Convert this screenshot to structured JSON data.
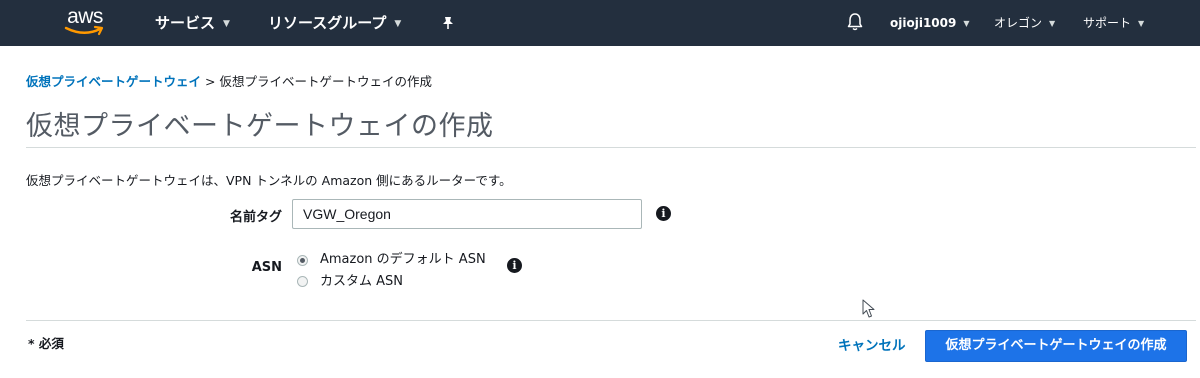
{
  "header": {
    "logo_text": "aws",
    "services_label": "サービス",
    "resource_groups_label": "リソースグループ",
    "pin_icon": "pin-icon",
    "bell_icon": "bell-icon",
    "account_label": "ojioji1009",
    "region_label": "オレゴン",
    "support_label": "サポート",
    "colors": {
      "nav_bg": "#232f3e",
      "logo_smile": "#ff9900"
    }
  },
  "breadcrumb": {
    "parent": "仮想プライベートゲートウェイ",
    "separator": ">",
    "current": "仮想プライベートゲートウェイの作成"
  },
  "page": {
    "title": "仮想プライベートゲートウェイの作成",
    "description": "仮想プライベートゲートウェイは、VPN トンネルの Amazon 側にあるルーターです。"
  },
  "form": {
    "name_tag": {
      "label": "名前タグ",
      "value": "VGW_Oregon"
    },
    "asn": {
      "label": "ASN",
      "options": [
        {
          "label": "Amazon のデフォルト ASN",
          "selected": true
        },
        {
          "label": "カスタム ASN",
          "selected": false
        }
      ]
    }
  },
  "footer": {
    "required_note": "* 必須",
    "cancel_label": "キャンセル",
    "submit_label": "仮想プライベートゲートウェイの作成",
    "colors": {
      "link": "#0073bb",
      "primary": "#1d73e8"
    }
  }
}
